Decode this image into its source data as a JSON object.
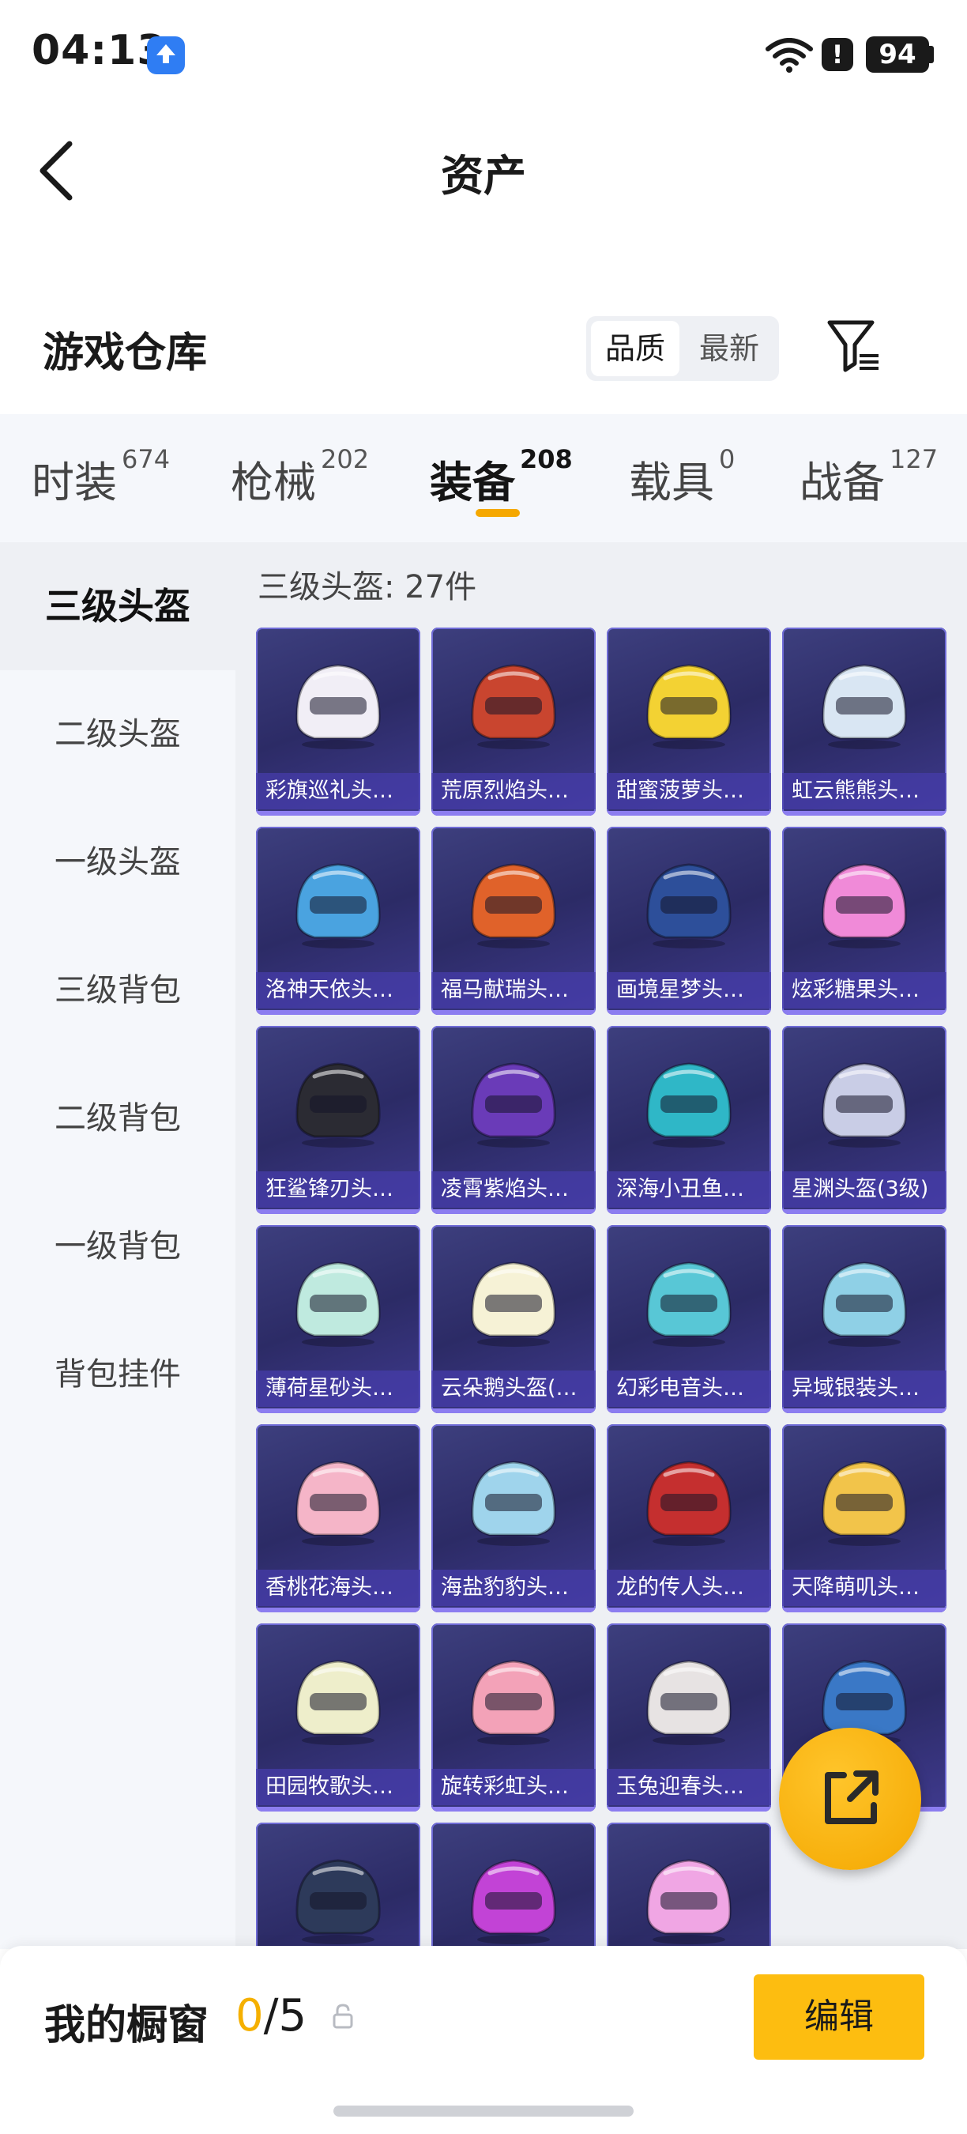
{
  "status_bar": {
    "time": "04:13",
    "battery": "94",
    "alert_glyph": "!",
    "icons": [
      "upload-app-icon",
      "wifi-icon",
      "alert-icon",
      "battery-icon"
    ]
  },
  "header": {
    "title": "资产"
  },
  "warehouse": {
    "title": "游戏仓库",
    "sort_options": [
      "品质",
      "最新"
    ],
    "selected_sort": "品质"
  },
  "tabs": [
    {
      "label": "时装",
      "count": "674"
    },
    {
      "label": "枪械",
      "count": "202"
    },
    {
      "label": "装备",
      "count": "208"
    },
    {
      "label": "载具",
      "count": "0"
    },
    {
      "label": "战备",
      "count": "127"
    }
  ],
  "active_tab": "装备",
  "sidebar": {
    "active": "三级头盔",
    "items": [
      "三级头盔",
      "二级头盔",
      "一级头盔",
      "三级背包",
      "二级背包",
      "一级背包",
      "背包挂件"
    ]
  },
  "grid": {
    "title": "三级头盔: 27件",
    "items": [
      "彩旗巡礼头…",
      "荒原烈焰头…",
      "甜蜜菠萝头…",
      "虹云熊熊头…",
      "洛神天依头…",
      "福马献瑞头…",
      "画境星梦头…",
      "炫彩糖果头…",
      "狂鲨锋刃头…",
      "凌霄紫焰头…",
      "深海小丑鱼…",
      "星渊头盔(3级)",
      "薄荷星砂头…",
      "云朵鹅头盔(…",
      "幻彩电音头…",
      "异域银装头…",
      "香桃花海头…",
      "海盐豹豹头…",
      "龙的传人头…",
      "天降萌叽头…",
      "田园牧歌头…",
      "旋转彩虹头…",
      "玉兔迎春头…",
      "",
      "",
      "",
      ""
    ],
    "helmet_colors": [
      "#f1eef6",
      "#c9452f",
      "#f3d233",
      "#d9e6f3",
      "#4aa3e0",
      "#e0622a",
      "#2d4f9a",
      "#f08ad8",
      "#2b2b33",
      "#6a3bb8",
      "#2fb7c7",
      "#c9cde6",
      "#bfeadf",
      "#f6f2d6",
      "#58c7d6",
      "#8fd0e6",
      "#f5b5c8",
      "#9fd4ec",
      "#c52f2f",
      "#f2c44a",
      "#eeeecb",
      "#f3a2b8",
      "#e7e3e3",
      "#3a78c6",
      "#2d3a5a",
      "#c243d6",
      "#f0a6e4"
    ]
  },
  "fab": {
    "icon": "share-external-icon"
  },
  "showcase": {
    "label": "我的橱窗",
    "current": "0",
    "separator": "/",
    "max": "5",
    "edit_label": "编辑"
  }
}
